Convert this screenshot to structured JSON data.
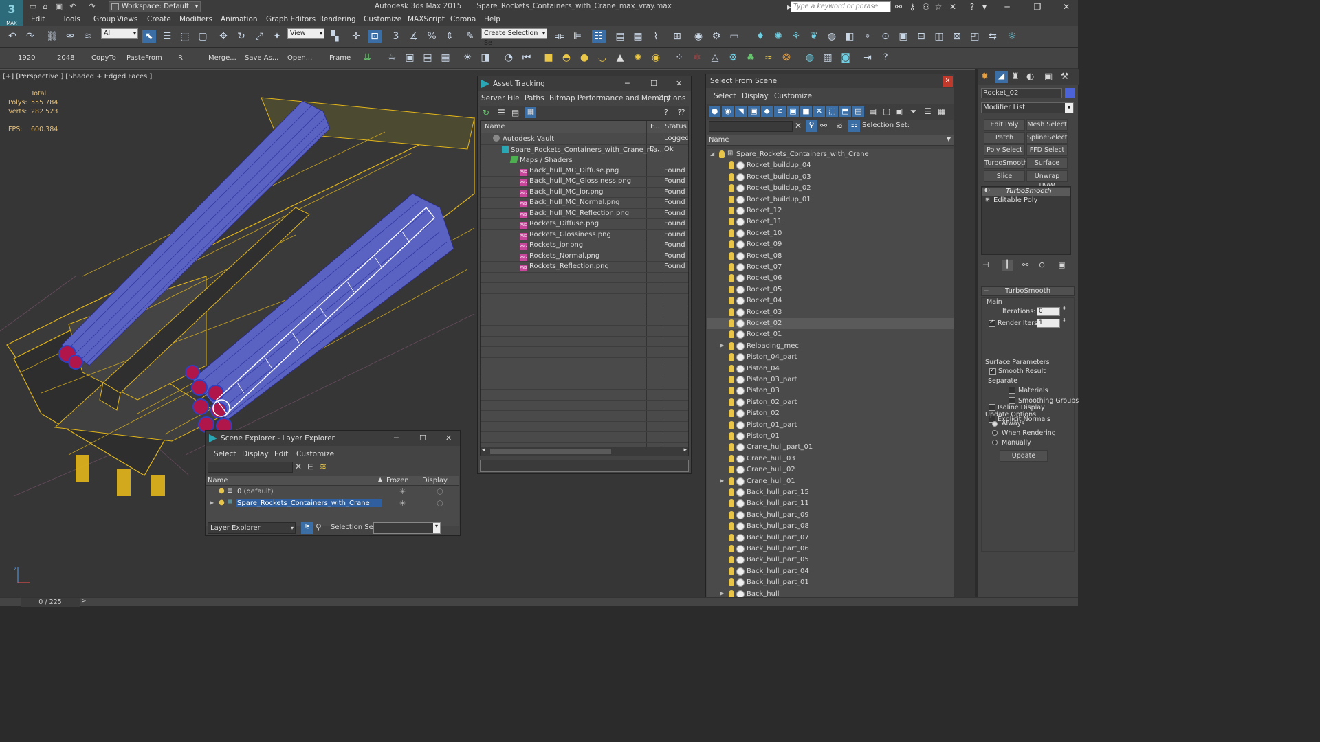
{
  "app": {
    "title": "Autodesk 3ds Max  2015",
    "file": "Spare_Rockets_Containers_with_Crane_max_vray.max",
    "logo": "MAX",
    "workspace": "Workspace: Default",
    "search_placeholder": "Type a keyword or phrase"
  },
  "menu": [
    "Edit",
    "Tools",
    "Group",
    "Views",
    "Create",
    "Modifiers",
    "Animation",
    "Graph Editors",
    "Rendering",
    "Customize",
    "MAXScript",
    "Corona",
    "Help"
  ],
  "toolbar": {
    "filter_value": "All",
    "view_value": "View",
    "selection_set_placeholder": "Create Selection Se"
  },
  "toolbar2": {
    "labels": [
      "1920",
      "2048",
      "CopyTo",
      "PasteFrom",
      "R",
      "Merge...",
      "Save As...",
      "Open...",
      "Frame"
    ]
  },
  "viewport": {
    "label": "[+] [Perspective ] [Shaded + Edged Faces ]",
    "stats": {
      "header": "Total",
      "polys_label": "Polys:",
      "polys": "555 784",
      "verts_label": "Verts:",
      "verts": "282 523",
      "fps_label": "FPS:",
      "fps": "600.384"
    },
    "colors": {
      "wire": "#e3b61b",
      "rockets": "#4b55c8",
      "tips": "#b0164a",
      "selected": "#ffffff"
    }
  },
  "status": {
    "frame_counter": "0 / 225",
    "next": ">"
  },
  "asset_tracking": {
    "title": "Asset Tracking",
    "menu": [
      "Server",
      "File",
      "Paths",
      "Bitmap Performance and Memory",
      "Options"
    ],
    "columns": {
      "name": "Name",
      "f": "F...",
      "status": "Status"
    },
    "rows": [
      {
        "name": "Autodesk Vault",
        "f": "",
        "status": "Logged",
        "indent": 0,
        "icon": "vault"
      },
      {
        "name": "Spare_Rockets_Containers_with_Crane_ma...",
        "f": "D..",
        "status": "Ok",
        "indent": 1,
        "icon": "file"
      },
      {
        "name": "Maps / Shaders",
        "f": "",
        "status": "",
        "indent": 2,
        "icon": "map"
      },
      {
        "name": "Back_hull_MC_Diffuse.png",
        "f": "",
        "status": "Found",
        "indent": 3,
        "icon": "png"
      },
      {
        "name": "Back_hull_MC_Glossiness.png",
        "f": "",
        "status": "Found",
        "indent": 3,
        "icon": "png"
      },
      {
        "name": "Back_hull_MC_ior.png",
        "f": "",
        "status": "Found",
        "indent": 3,
        "icon": "png"
      },
      {
        "name": "Back_hull_MC_Normal.png",
        "f": "",
        "status": "Found",
        "indent": 3,
        "icon": "png"
      },
      {
        "name": "Back_hull_MC_Reflection.png",
        "f": "",
        "status": "Found",
        "indent": 3,
        "icon": "png"
      },
      {
        "name": "Rockets_Diffuse.png",
        "f": "",
        "status": "Found",
        "indent": 3,
        "icon": "png"
      },
      {
        "name": "Rockets_Glossiness.png",
        "f": "",
        "status": "Found",
        "indent": 3,
        "icon": "png"
      },
      {
        "name": "Rockets_ior.png",
        "f": "",
        "status": "Found",
        "indent": 3,
        "icon": "png"
      },
      {
        "name": "Rockets_Normal.png",
        "f": "",
        "status": "Found",
        "indent": 3,
        "icon": "png"
      },
      {
        "name": "Rockets_Reflection.png",
        "f": "",
        "status": "Found",
        "indent": 3,
        "icon": "png"
      }
    ]
  },
  "scene_explorer": {
    "title": "Scene Explorer - Layer Explorer",
    "menu": [
      "Select",
      "Display",
      "Edit",
      "Customize"
    ],
    "columns": {
      "name": "Name",
      "frozen": "Frozen",
      "display": "Display as..."
    },
    "rows": [
      {
        "name": "0 (default)",
        "selected": false
      },
      {
        "name": "Spare_Rockets_Containers_with_Crane",
        "selected": true
      }
    ],
    "footer_combo": "Layer Explorer",
    "selection_set_label": "Selection Set:"
  },
  "select_from_scene": {
    "title": "Select From Scene",
    "menu": [
      "Select",
      "Display",
      "Customize"
    ],
    "selection_set_label": "Selection Set:",
    "column_name": "Name",
    "root": "Spare_Rockets_Containers_with_Crane",
    "items": [
      {
        "name": "Rocket_buildup_04"
      },
      {
        "name": "Rocket_buildup_03"
      },
      {
        "name": "Rocket_buildup_02"
      },
      {
        "name": "Rocket_buildup_01"
      },
      {
        "name": "Rocket_12"
      },
      {
        "name": "Rocket_11"
      },
      {
        "name": "Rocket_10"
      },
      {
        "name": "Rocket_09"
      },
      {
        "name": "Rocket_08"
      },
      {
        "name": "Rocket_07"
      },
      {
        "name": "Rocket_06"
      },
      {
        "name": "Rocket_05"
      },
      {
        "name": "Rocket_04"
      },
      {
        "name": "Rocket_03"
      },
      {
        "name": "Rocket_02",
        "selected": true
      },
      {
        "name": "Rocket_01"
      },
      {
        "name": "Reloading_mec",
        "expandable": true
      },
      {
        "name": "Piston_04_part"
      },
      {
        "name": "Piston_04"
      },
      {
        "name": "Piston_03_part"
      },
      {
        "name": "Piston_03"
      },
      {
        "name": "Piston_02_part"
      },
      {
        "name": "Piston_02"
      },
      {
        "name": "Piston_01_part"
      },
      {
        "name": "Piston_01"
      },
      {
        "name": "Crane_hull_part_01"
      },
      {
        "name": "Crane_hull_03"
      },
      {
        "name": "Crane_hull_02"
      },
      {
        "name": "Crane_hull_01",
        "expandable": true
      },
      {
        "name": "Back_hull_part_15"
      },
      {
        "name": "Back_hull_part_11"
      },
      {
        "name": "Back_hull_part_09"
      },
      {
        "name": "Back_hull_part_08"
      },
      {
        "name": "Back_hull_part_07"
      },
      {
        "name": "Back_hull_part_06"
      },
      {
        "name": "Back_hull_part_05"
      },
      {
        "name": "Back_hull_part_04"
      },
      {
        "name": "Back_hull_part_01"
      },
      {
        "name": "Back_hull",
        "expandable": true
      }
    ]
  },
  "command_panel": {
    "object_name": "Rocket_02",
    "modifier_list": "Modifier List",
    "buttons": [
      "Edit Poly",
      "Mesh Select",
      "Patch Select",
      "SplineSelect",
      "Poly Select",
      "FFD Select",
      "TurboSmooth",
      "Surface Select",
      "Slice",
      "Unwrap UVW"
    ],
    "stack": [
      "TurboSmooth",
      "Editable Poly"
    ],
    "rollout_title": "TurboSmooth",
    "main_label": "Main",
    "iterations_label": "Iterations:",
    "iterations": "0",
    "render_iters_label": "Render Iters:",
    "render_iters": "1",
    "isoline": "Isoline Display",
    "explicit_normals": "Explicit Normals",
    "surface_params": "Surface Parameters",
    "smooth_result": "Smooth Result",
    "separate": "Separate",
    "materials": "Materials",
    "smoothing_groups": "Smoothing Groups",
    "update_options": "Update Options",
    "always": "Always",
    "when_rendering": "When Rendering",
    "manually": "Manually",
    "update": "Update"
  }
}
